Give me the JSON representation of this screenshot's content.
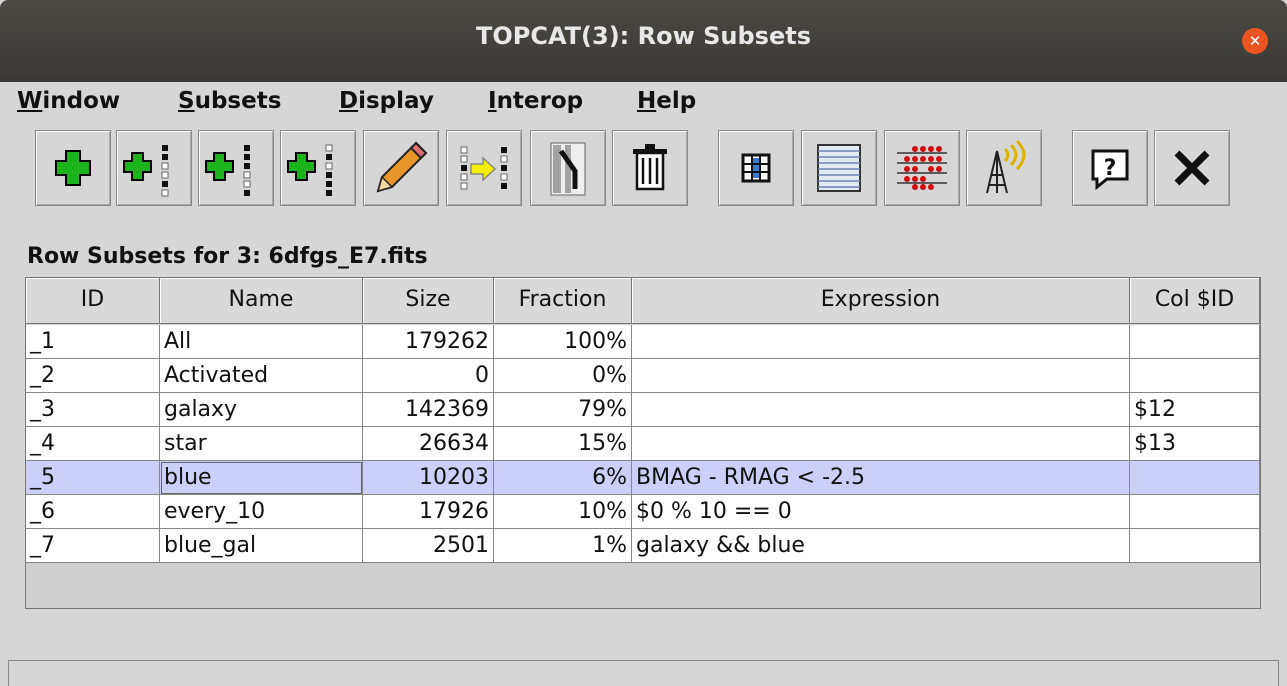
{
  "window": {
    "title": "TOPCAT(3): Row Subsets"
  },
  "menu": [
    {
      "mnemonic": "W",
      "rest": "indow"
    },
    {
      "mnemonic": "S",
      "rest": "ubsets"
    },
    {
      "mnemonic": "D",
      "rest": "isplay"
    },
    {
      "mnemonic": "I",
      "rest": "nterop"
    },
    {
      "mnemonic": "H",
      "rest": "elp"
    }
  ],
  "toolbar": [
    "add-subset-icon",
    "add-subset-column-icon",
    "add-subset-column-icon-2",
    "add-subset-column-icon-3",
    "edit-pencil-icon",
    "import-subset-icon",
    "invert-subset-icon",
    "delete-trash-icon",
    "column-info-icon",
    "table-data-icon",
    "statistics-icon",
    "broadcast-icon",
    "help-icon",
    "close-x-icon"
  ],
  "section_title": "Row Subsets for 3: 6dfgs_E7.fits",
  "table": {
    "columns": [
      "ID",
      "Name",
      "Size",
      "Fraction",
      "Expression",
      "Col $ID"
    ],
    "rows": [
      {
        "id": "_1",
        "name": "All",
        "size": "179262",
        "fraction": "100%",
        "expression": "",
        "col": ""
      },
      {
        "id": "_2",
        "name": "Activated",
        "size": "0",
        "fraction": "0%",
        "expression": "",
        "col": ""
      },
      {
        "id": "_3",
        "name": "galaxy",
        "size": "142369",
        "fraction": "79%",
        "expression": "",
        "col": "$12"
      },
      {
        "id": "_4",
        "name": "star",
        "size": "26634",
        "fraction": "15%",
        "expression": "",
        "col": "$13"
      },
      {
        "id": "_5",
        "name": "blue",
        "size": "10203",
        "fraction": "6%",
        "expression": "BMAG - RMAG < -2.5",
        "col": ""
      },
      {
        "id": "_6",
        "name": "every_10",
        "size": "17926",
        "fraction": "10%",
        "expression": "$0 % 10 == 0",
        "col": ""
      },
      {
        "id": "_7",
        "name": "blue_gal",
        "size": "2501",
        "fraction": "1%",
        "expression": "galaxy && blue",
        "col": ""
      }
    ],
    "selected_row": 4
  },
  "colors": {
    "selection": "#cccff7",
    "close": "#e95420"
  }
}
